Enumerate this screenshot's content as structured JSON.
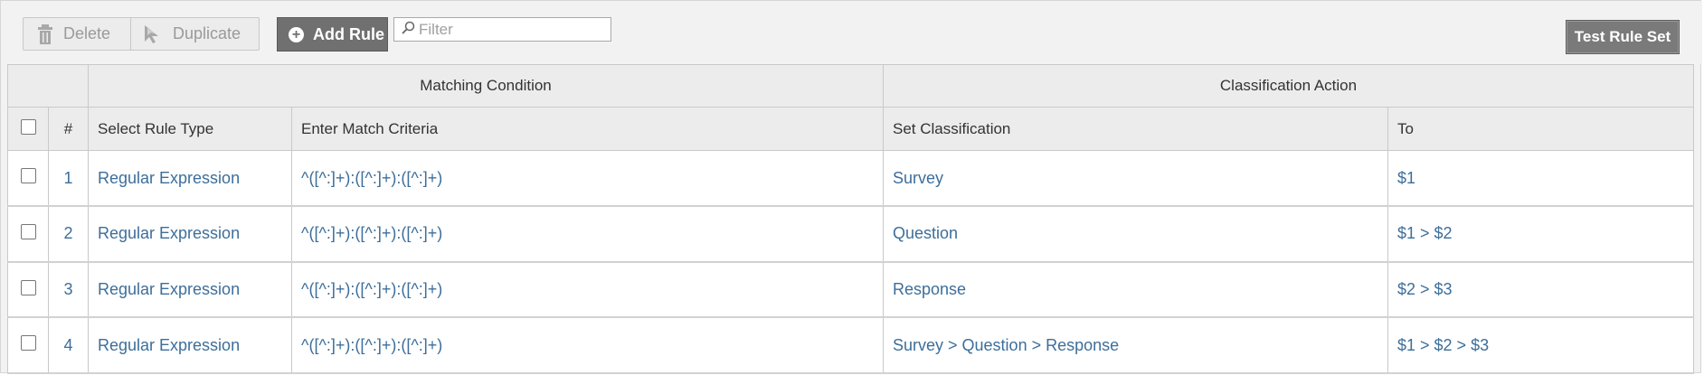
{
  "toolbar": {
    "delete_label": "Delete",
    "duplicate_label": "Duplicate",
    "add_rule_label": "Add Rule",
    "filter_placeholder": "Filter",
    "filter_value": "",
    "test_rule_set_label": "Test Rule Set"
  },
  "table": {
    "group_headers": [
      "Matching Condition",
      "Classification Action"
    ],
    "columns": {
      "number": "#",
      "rule_type": "Select Rule Type",
      "match_criteria": "Enter Match Criteria",
      "set_classification": "Set Classification",
      "to": "To"
    },
    "rows": [
      {
        "number": "1",
        "rule_type": "Regular Expression",
        "match_criteria": "^([^:]+):([^:]+):([^:]+)",
        "set_classification": "Survey",
        "to": "$1",
        "checked": false
      },
      {
        "number": "2",
        "rule_type": "Regular Expression",
        "match_criteria": "^([^:]+):([^:]+):([^:]+)",
        "set_classification": "Question",
        "to": "$1 > $2",
        "checked": false
      },
      {
        "number": "3",
        "rule_type": "Regular Expression",
        "match_criteria": "^([^:]+):([^:]+):([^:]+)",
        "set_classification": "Response",
        "to": "$2 > $3",
        "checked": false
      },
      {
        "number": "4",
        "rule_type": "Regular Expression",
        "match_criteria": "^([^:]+):([^:]+):([^:]+)",
        "set_classification": "Survey > Question > Response",
        "to": "$1 > $2 > $3",
        "checked": false
      }
    ]
  },
  "colors": {
    "link": "#3d6e9a",
    "toolbar_bg": "#f2f2f2",
    "header_bg": "#ececec",
    "primary_button": "#707070"
  },
  "icons": {
    "delete": "trash-icon",
    "duplicate": "duplicate-cursor-icon",
    "add": "plus-circle-icon",
    "filter": "search-icon"
  }
}
